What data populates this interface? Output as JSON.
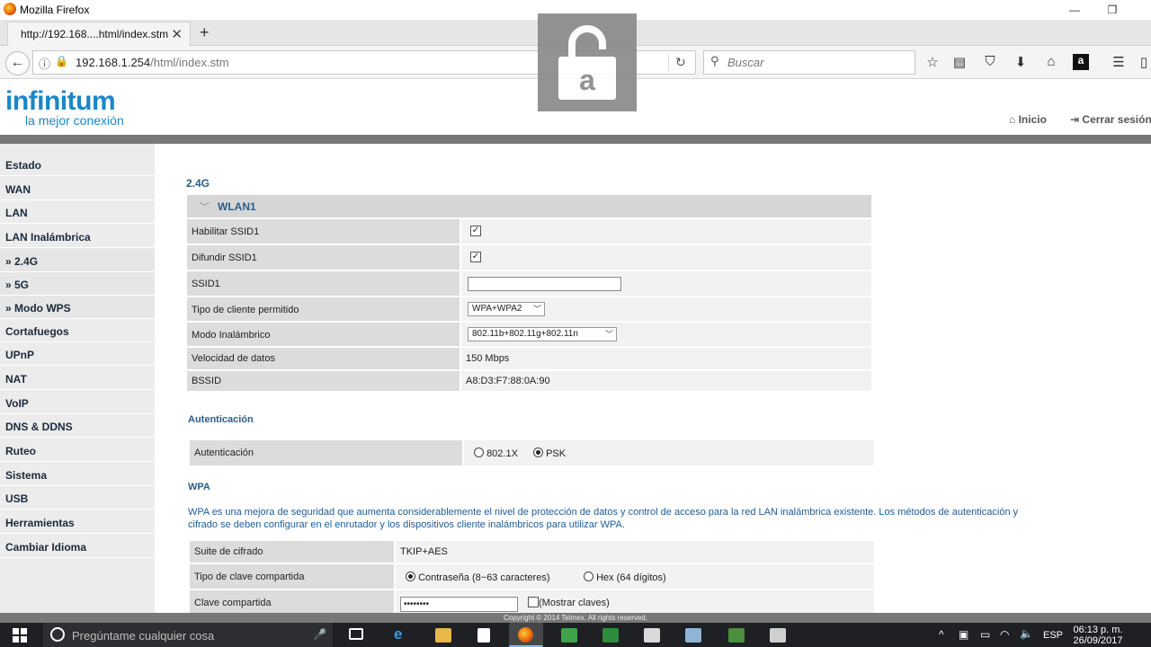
{
  "window": {
    "title": "Mozilla Firefox"
  },
  "tab": {
    "title": "http://192.168....html/index.stm"
  },
  "url": {
    "host": "192.168.1.254",
    "path": "/html/index.stm"
  },
  "search": {
    "placeholder": "Buscar"
  },
  "brand": {
    "name": "infinitum",
    "tagline": "la mejor conexión"
  },
  "header_links": {
    "home": "Inicio",
    "logout": "Cerrar sesión"
  },
  "sidebar": {
    "items": [
      {
        "label": "Estado"
      },
      {
        "label": "WAN"
      },
      {
        "label": "LAN"
      },
      {
        "label": "LAN Inalámbrica"
      },
      {
        "label": "» 2.4G"
      },
      {
        "label": "» 5G"
      },
      {
        "label": "» Modo WPS"
      },
      {
        "label": "Cortafuegos"
      },
      {
        "label": "UPnP"
      },
      {
        "label": "NAT"
      },
      {
        "label": "VoIP"
      },
      {
        "label": "DNS & DDNS"
      },
      {
        "label": "Ruteo"
      },
      {
        "label": "Sistema"
      },
      {
        "label": "USB"
      },
      {
        "label": "Herramientas"
      },
      {
        "label": "Cambiar Idioma"
      }
    ]
  },
  "main": {
    "band_title": "2.4G",
    "wlan_header": "WLAN1",
    "rows": {
      "enable_ssid": "Habilitar SSID1",
      "broadcast_ssid": "Difundir SSID1",
      "ssid": "SSID1",
      "client_type": "Tipo de cliente permitido",
      "client_type_value": "WPA+WPA2",
      "wireless_mode": "Modo Inalámbrico",
      "wireless_mode_value": "802.11b+802.11g+802.11n",
      "data_rate": "Velocidad de datos",
      "data_rate_value": "150 Mbps",
      "bssid": "BSSID",
      "bssid_value": "A8:D3:F7:88:0A:90"
    },
    "auth_title": "Autenticación",
    "auth_label": "Autenticación",
    "auth_opt1": "802.1X",
    "auth_opt2": "PSK",
    "wpa_title": "WPA",
    "wpa_text": "WPA es una mejora de seguridad que aumenta considerablemente el nivel de protección de datos y control de acceso para la red LAN inalámbrica existente. Los métodos de autenticación y cifrado se deben configurar en el enrutador y los dispositivos cliente inalámbricos para utilizar WPA.",
    "cipher_label": "Suite de cifrado",
    "cipher_value": "TKIP+AES",
    "key_type_label": "Tipo de clave compartida",
    "key_type_opt1": "Contraseña (8~63 caracteres)",
    "key_type_opt2": "Hex (64 dígitos)",
    "shared_key_label": "Clave compartida",
    "shared_key_value": "••••••••",
    "show_keys": "(Mostrar claves)"
  },
  "copyright": "Copyright © 2014 Telmex. All rights reserved.",
  "taskbar": {
    "search_placeholder": "Pregúntame cualquier cosa",
    "lang": "ESP",
    "time": "06:13 p. m.",
    "date": "26/09/2017"
  }
}
